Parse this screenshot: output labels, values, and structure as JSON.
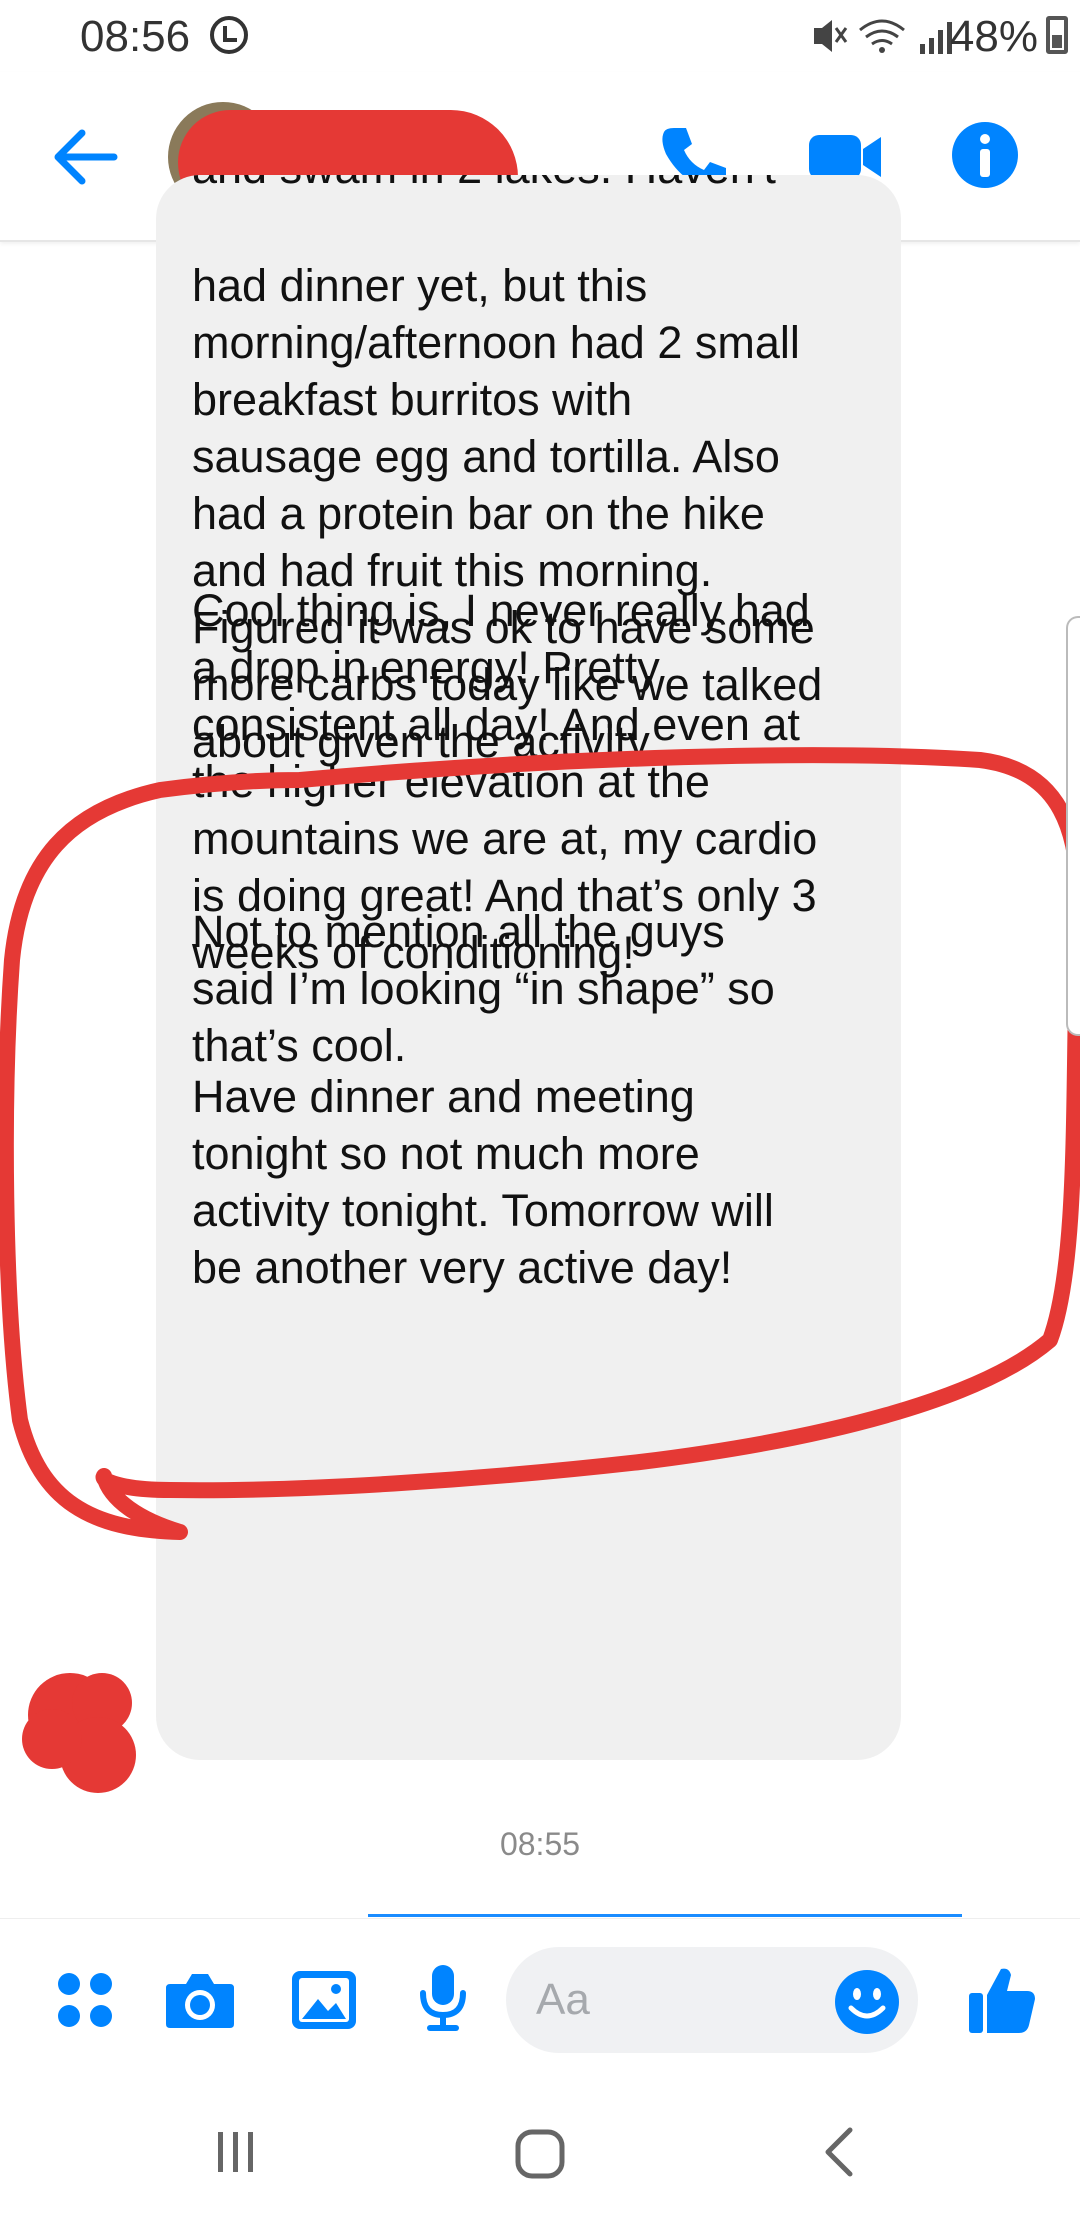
{
  "status_bar": {
    "time": "08:56",
    "battery": "48%"
  },
  "header": {
    "back_icon": "arrow-left-icon",
    "call_icon": "phone-icon",
    "video_icon": "video-camera-icon",
    "info_icon": "info-icon",
    "accent_color": "#0084ff"
  },
  "conversation": {
    "cut_off_line": "and swam in 2 lakes. Haven't",
    "messages": [
      {
        "text": "had dinner yet, but this\nmorning/afternoon had 2 small\nbreakfast burritos with\nsausage egg and tortilla. Also\nhad a protein bar on the hike\nand had fruit this morning.\nFigured it was ok to have some\nmore carbs today like we talked\nabout given the activity."
      },
      {
        "text": "Cool thing is, I never really had\na drop in energy! Pretty\nconsistent all day! And even at\nthe higher elevation at the\nmountains we are at, my cardio\nis doing great! And that’s only 3\nweeks of conditioning!"
      },
      {
        "text": "Not to mention all the guys\nsaid I’m looking “in shape” so\nthat’s cool."
      },
      {
        "text": "Have dinner and meeting\ntonight so not much more\nactivity tonight. Tomorrow will\nbe another very active day!"
      }
    ],
    "timestamp": "08:55",
    "annotation_color": "#e53935"
  },
  "composer": {
    "placeholder": "Aa",
    "icons": [
      "four-dots-icon",
      "camera-icon",
      "image-icon",
      "microphone-icon",
      "emoji-icon",
      "thumbs-up-icon"
    ]
  },
  "nav": {
    "icons": [
      "recent-apps-icon",
      "home-icon",
      "back-icon"
    ]
  }
}
